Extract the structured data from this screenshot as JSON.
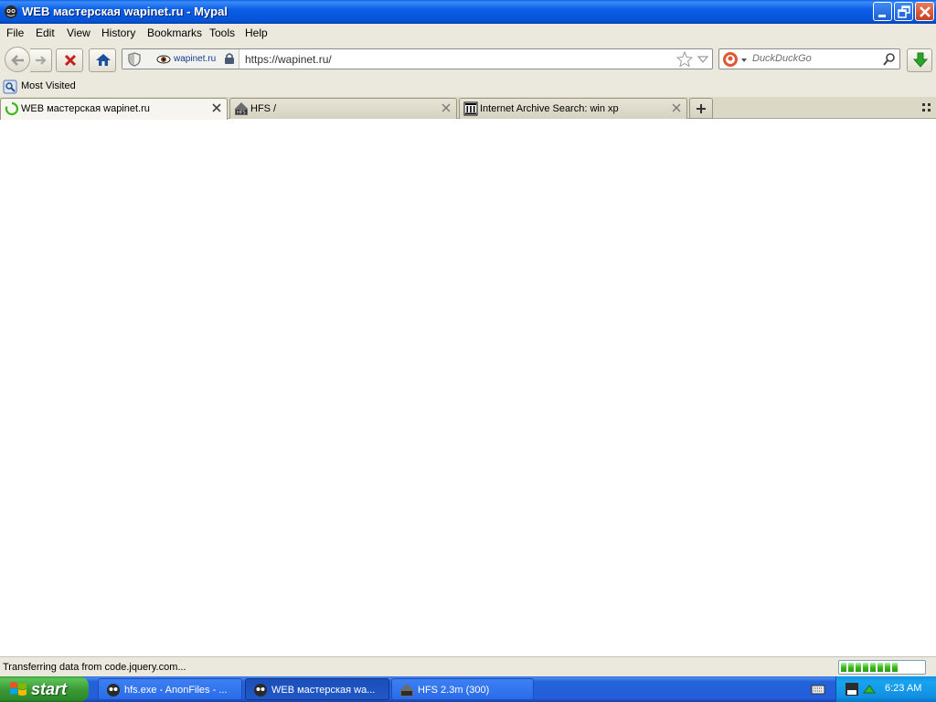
{
  "window": {
    "title": "WEB мастерская wapinet.ru - Mypal"
  },
  "menu": {
    "items": [
      "File",
      "Edit",
      "View",
      "History",
      "Bookmarks",
      "Tools",
      "Help"
    ]
  },
  "navbar": {
    "site_identity": "wapinet.ru",
    "url": "https://wapinet.ru/",
    "search_placeholder": "DuckDuckGo"
  },
  "bookmarks": {
    "items": [
      "Most Visited"
    ]
  },
  "tabs": [
    {
      "label": "WEB мастерская wapinet.ru",
      "active": true,
      "loading": true
    },
    {
      "label": "HFS /",
      "active": false
    },
    {
      "label": "Internet Archive Search: win xp",
      "active": false
    }
  ],
  "status": {
    "text": "Transferring data from code.jquery.com...",
    "progress_fraction": 0.7
  },
  "taskbar": {
    "start_label": "start",
    "tasks": [
      {
        "label": "hfs.exe - AnonFiles - ...",
        "active": false
      },
      {
        "label": "WEB мастерская wa...",
        "active": true
      },
      {
        "label": "HFS 2.3m (300)",
        "active": false
      }
    ],
    "clock": "6:23 AM"
  },
  "colors": {
    "title_bar": "#0b5ee6",
    "chrome": "#ebe9dd",
    "taskbar": "#245edb",
    "start_green": "#3b9a35",
    "progress_green": "#3cb81f"
  }
}
